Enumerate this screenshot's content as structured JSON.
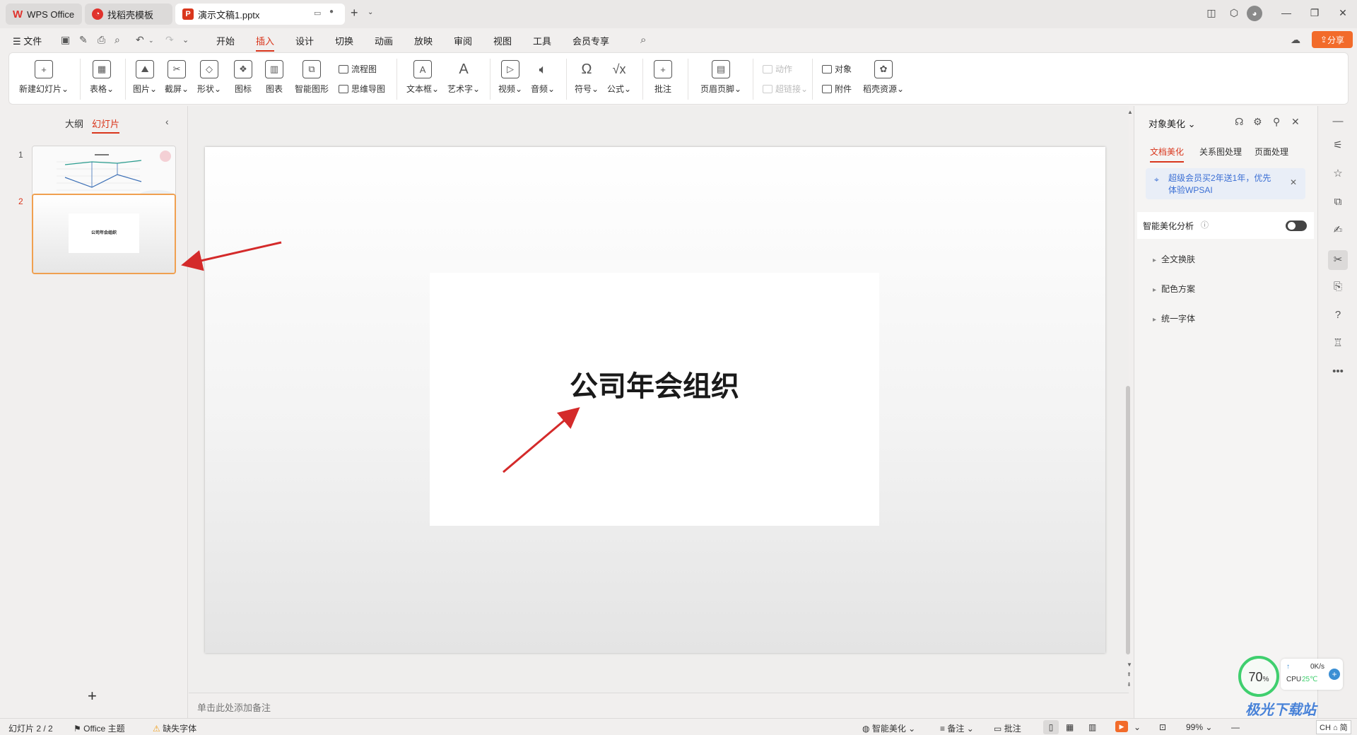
{
  "tabs": [
    {
      "label": "WPS Office",
      "logo": "W"
    },
    {
      "label": "找稻壳模板"
    },
    {
      "label": "演示文稿1.pptx",
      "logo": "P"
    }
  ],
  "window": {
    "minimize": "—",
    "restore": "❐",
    "close": "✕"
  },
  "menu": {
    "file": "文件",
    "items": [
      "开始",
      "插入",
      "设计",
      "切换",
      "动画",
      "放映",
      "审阅",
      "视图",
      "工具",
      "会员专享"
    ],
    "active": "插入",
    "share": "分享"
  },
  "ribbon": {
    "new_slide": "新建幻灯片",
    "table": "表格",
    "picture": "图片",
    "screenshot": "截屏",
    "shape": "形状",
    "icon": "图标",
    "chart": "图表",
    "smart_graphic": "智能图形",
    "flowchart": "流程图",
    "mindmap": "思维导图",
    "textbox": "文本框",
    "wordart": "艺术字",
    "video": "视频",
    "audio": "音频",
    "symbol": "符号",
    "formula": "公式",
    "comment": "批注",
    "header_footer": "页眉页脚",
    "action": "动作",
    "hyperlink": "超链接",
    "object": "对象",
    "attachment": "附件",
    "docer": "稻壳资源"
  },
  "left_panel": {
    "tab_outline": "大纲",
    "tab_slides": "幻灯片",
    "slides": [
      {
        "num": "1"
      },
      {
        "num": "2",
        "title": "公司年会组织"
      }
    ],
    "add": "+"
  },
  "slide": {
    "title": "公司年会组织"
  },
  "notes_placeholder": "单击此处添加备注",
  "right_panel": {
    "title": "对象美化",
    "tabs": [
      "文档美化",
      "关系图处理",
      "页面处理"
    ],
    "promo": "超级会员买2年送1年，优先体验WPSAI",
    "smart_analysis": "智能美化分析",
    "sections": [
      "全文换肤",
      "配色方案",
      "统一字体"
    ]
  },
  "statusbar": {
    "slide_count": "幻灯片 2 / 2",
    "theme": "Office 主题",
    "missing_font": "缺失字体",
    "smart_beautify": "智能美化",
    "notes": "备注",
    "comments": "批注",
    "zoom": "99%"
  },
  "widget": {
    "cpu_percent": "70",
    "net_speed": "0K/s",
    "cpu_label": "CPU",
    "cpu_temp": "25℃",
    "ime": "CH ⌂ 简"
  },
  "watermark": "极光下载站",
  "colors": {
    "accent": "#d9361c",
    "share": "#f26b2a",
    "selection": "#f0a050",
    "arrow": "#d42a2a"
  }
}
